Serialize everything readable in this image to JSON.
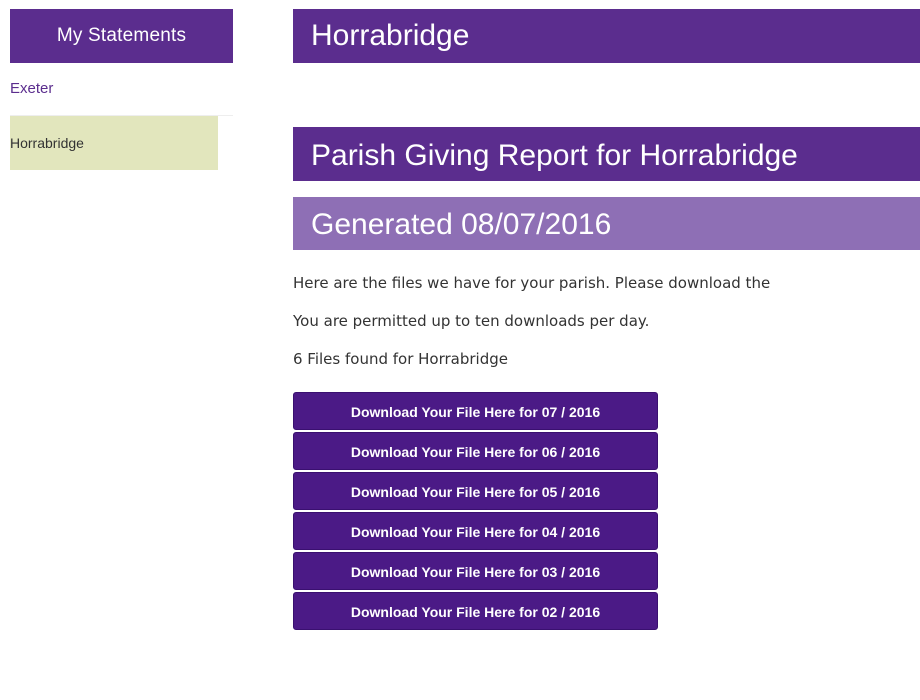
{
  "sidebar": {
    "header": "My Statements",
    "items": [
      {
        "label": "Exeter",
        "active": false
      },
      {
        "label": "Horrabridge",
        "active": true
      }
    ]
  },
  "main": {
    "title": "Horrabridge",
    "report_title": "Parish Giving Report for Horrabridge",
    "generated": "Generated 08/07/2016",
    "intro_text": "Here are the files we have for your parish. Please download the",
    "limit_text": "You are permitted up to ten downloads per day.",
    "files_found": "6 Files found for Horrabridge",
    "downloads": [
      {
        "label": "Download Your File Here for 07 / 2016"
      },
      {
        "label": "Download Your File Here for 06 / 2016"
      },
      {
        "label": "Download Your File Here for 05 / 2016"
      },
      {
        "label": "Download Your File Here for 04 / 2016"
      },
      {
        "label": "Download Your File Here for 03 / 2016"
      },
      {
        "label": "Download Your File Here for 02 / 2016"
      }
    ]
  },
  "colors": {
    "brand_purple": "#5b2d8e",
    "light_purple": "#8e6fb5",
    "button_purple": "#4b1a86",
    "active_highlight": "#e2e6bd"
  }
}
